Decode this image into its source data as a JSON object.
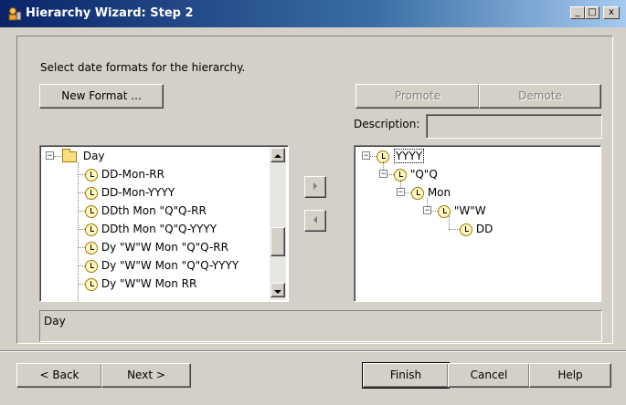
{
  "window": {
    "title": "Hierarchy Wizard: Step 2",
    "controls": {
      "minimize": "_",
      "maximize": "□",
      "close": "x"
    }
  },
  "instructions": "Select date formats for the hierarchy.",
  "buttons": {
    "new_format": "New Format ...",
    "promote": "Promote",
    "demote": "Demote",
    "move_right": "right",
    "move_left": "left",
    "back": "< Back",
    "next": "Next >",
    "finish": "Finish",
    "cancel": "Cancel",
    "help": "Help"
  },
  "description": {
    "label": "Description:",
    "value": ""
  },
  "available_formats": {
    "root": "Day",
    "items": [
      "DD-Mon-RR",
      "DD-Mon-YYYY",
      "DDth Mon \"Q\"Q-RR",
      "DDth Mon \"Q\"Q-YYYY",
      "Dy \"W\"W Mon \"Q\"Q-RR",
      "Dy \"W\"W Mon \"Q\"Q-YYYY",
      "Dy \"W\"W Mon RR"
    ]
  },
  "hierarchy": {
    "levels": [
      "YYYY",
      "\"Q\"Q",
      "Mon",
      "\"W\"W",
      "DD"
    ],
    "selected": "YYYY"
  },
  "status": {
    "text": "Day"
  },
  "colors": {
    "face": "#d4d0c8",
    "title_start": "#0a246a",
    "title_end": "#a6caf0",
    "disabled_text": "#808080"
  }
}
